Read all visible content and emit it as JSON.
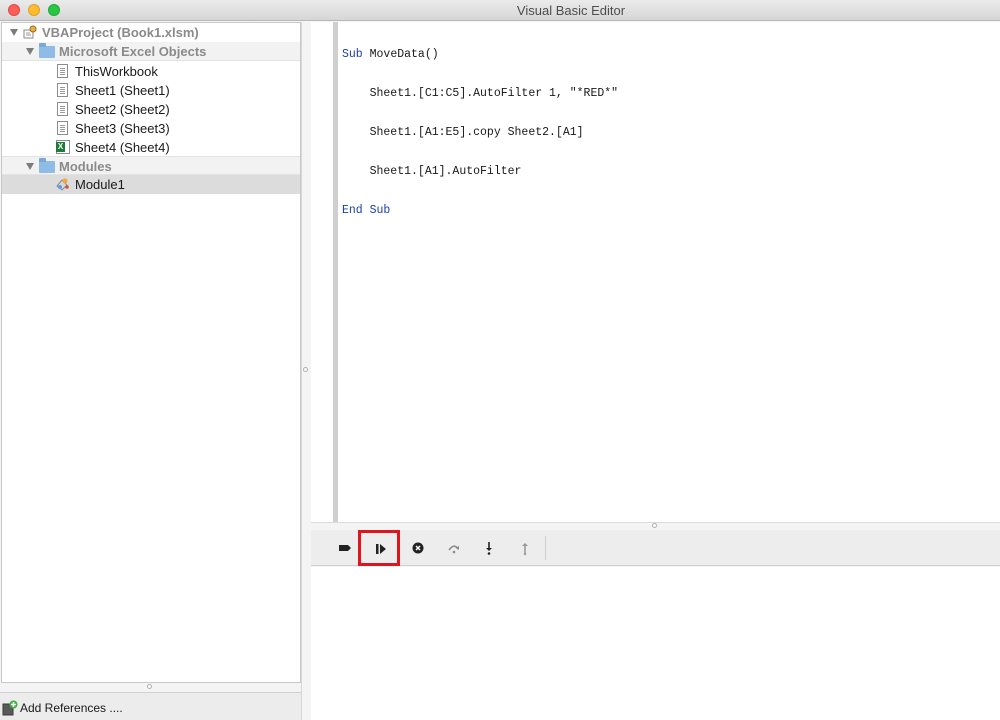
{
  "window": {
    "title": "Visual Basic Editor"
  },
  "project_tree": {
    "root": {
      "label": "VBAProject (Book1.xlsm)"
    },
    "groups": [
      {
        "label": "Microsoft Excel Objects",
        "items": [
          {
            "label": "ThisWorkbook",
            "icon": "document-icon"
          },
          {
            "label": "Sheet1 (Sheet1)",
            "icon": "document-icon"
          },
          {
            "label": "Sheet2 (Sheet2)",
            "icon": "document-icon"
          },
          {
            "label": "Sheet3 (Sheet3)",
            "icon": "document-icon"
          },
          {
            "label": "Sheet4 (Sheet4)",
            "icon": "excel-sheet-icon"
          }
        ]
      },
      {
        "label": "Modules",
        "items": [
          {
            "label": "Module1",
            "icon": "module-icon",
            "selected": true
          }
        ]
      }
    ]
  },
  "footer": {
    "add_references_label": "Add References ...."
  },
  "code": {
    "lines": [
      {
        "keyword": "Sub",
        "text": " MoveData()"
      },
      {
        "keyword": "",
        "text": "    Sheet1.[C1:C5].AutoFilter 1, \"*RED*\""
      },
      {
        "keyword": "",
        "text": "    Sheet1.[A1:E5].copy Sheet2.[A1]"
      },
      {
        "keyword": "",
        "text": "    Sheet1.[A1].AutoFilter"
      },
      {
        "keyword": "End Sub",
        "text": ""
      }
    ]
  },
  "debug_toolbar": {
    "buttons": [
      {
        "name": "toggle-breakpoint",
        "icon": "breakpoint-icon"
      },
      {
        "name": "run",
        "icon": "run-continue-icon",
        "highlighted": true
      },
      {
        "name": "stop",
        "icon": "stop-icon"
      },
      {
        "name": "step-over",
        "icon": "step-over-icon"
      },
      {
        "name": "step-into",
        "icon": "step-into-icon"
      },
      {
        "name": "step-out",
        "icon": "step-out-icon"
      }
    ],
    "highlight_color": "#e0141e"
  },
  "colors": {
    "keyword": "#1d3fa8",
    "selection": "#dcdcdc"
  }
}
